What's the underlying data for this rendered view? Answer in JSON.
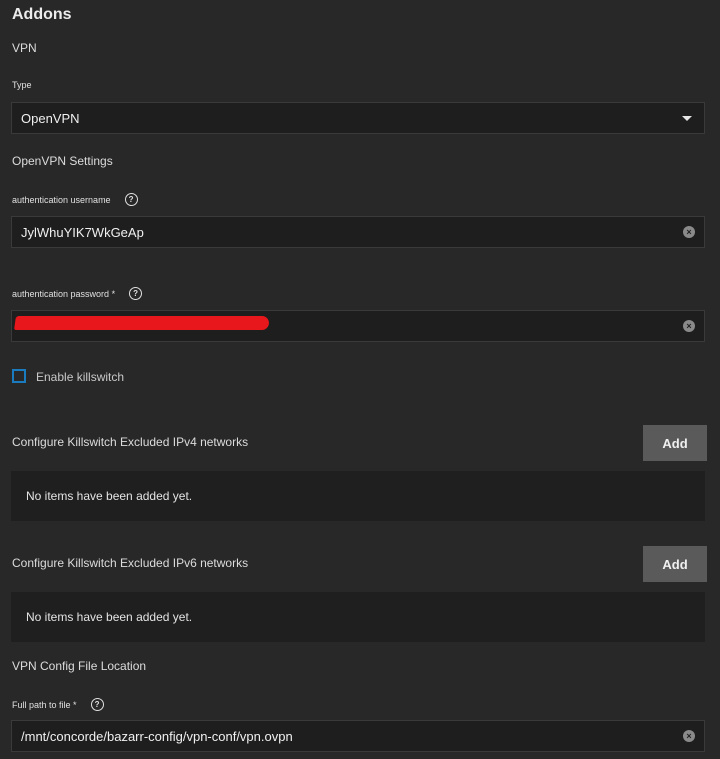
{
  "header": {
    "title": "Addons"
  },
  "vpn": {
    "section": "VPN",
    "type_label": "Type",
    "type_value": "OpenVPN"
  },
  "openvpn": {
    "section": "OpenVPN Settings",
    "username_label": "authentication username",
    "username_value": "JylWhuYIK7WkGeAp",
    "password_label": "authentication password *",
    "password_value": ""
  },
  "killswitch": {
    "label": "Enable killswitch",
    "checked": false
  },
  "ipv4": {
    "label": "Configure Killswitch Excluded IPv4 networks",
    "add_label": "Add",
    "empty_text": "No items have been added yet."
  },
  "ipv6": {
    "label": "Configure Killswitch Excluded IPv6 networks",
    "add_label": "Add",
    "empty_text": "No items have been added yet."
  },
  "config": {
    "section": "VPN Config File Location",
    "path_label": "Full path to file *",
    "path_value": "/mnt/concorde/bazarr-config/vpn-conf/vpn.ovpn"
  },
  "icons": {
    "help": "?",
    "clear": "×"
  },
  "colors": {
    "background": "#282828",
    "input": "#1e1e1e",
    "accent": "#1a7bbf",
    "button": "#5a5a5a",
    "redaction": "#e8171b"
  }
}
